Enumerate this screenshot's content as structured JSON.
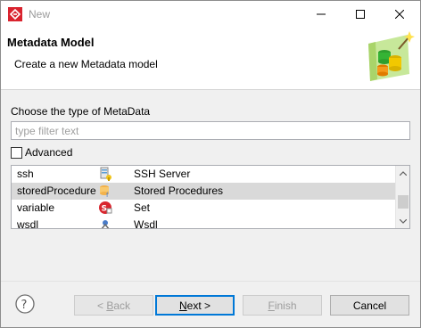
{
  "window": {
    "title": "New",
    "accent": "#c0392b"
  },
  "banner": {
    "title": "Metadata Model",
    "description": "Create a new Metadata model",
    "icon": "metadata-wizard-icon"
  },
  "chooser": {
    "label": "Choose the type of MetaData",
    "filter_placeholder": "type filter text",
    "filter_value": "",
    "advanced_label": "Advanced",
    "advanced_checked": false
  },
  "list": {
    "rows": [
      {
        "name": "ssh",
        "icon": "ssh-server-icon",
        "description": "SSH Server",
        "selected": false
      },
      {
        "name": "storedProcedure",
        "icon": "stored-procedure-icon",
        "description": "Stored Procedures",
        "selected": true
      },
      {
        "name": "variable",
        "icon": "set-variable-icon",
        "description": "Set",
        "selected": false
      },
      {
        "name": "wsdl",
        "icon": "wsdl-icon",
        "description": "Wsdl",
        "selected": false
      }
    ]
  },
  "buttons": {
    "back_mnemonic": "B",
    "back_rest": "ack",
    "back_prefix": "< ",
    "next_mnemonic": "N",
    "next_rest": "ext >",
    "finish_mnemonic": "F",
    "finish_rest": "inish",
    "cancel": "Cancel"
  }
}
